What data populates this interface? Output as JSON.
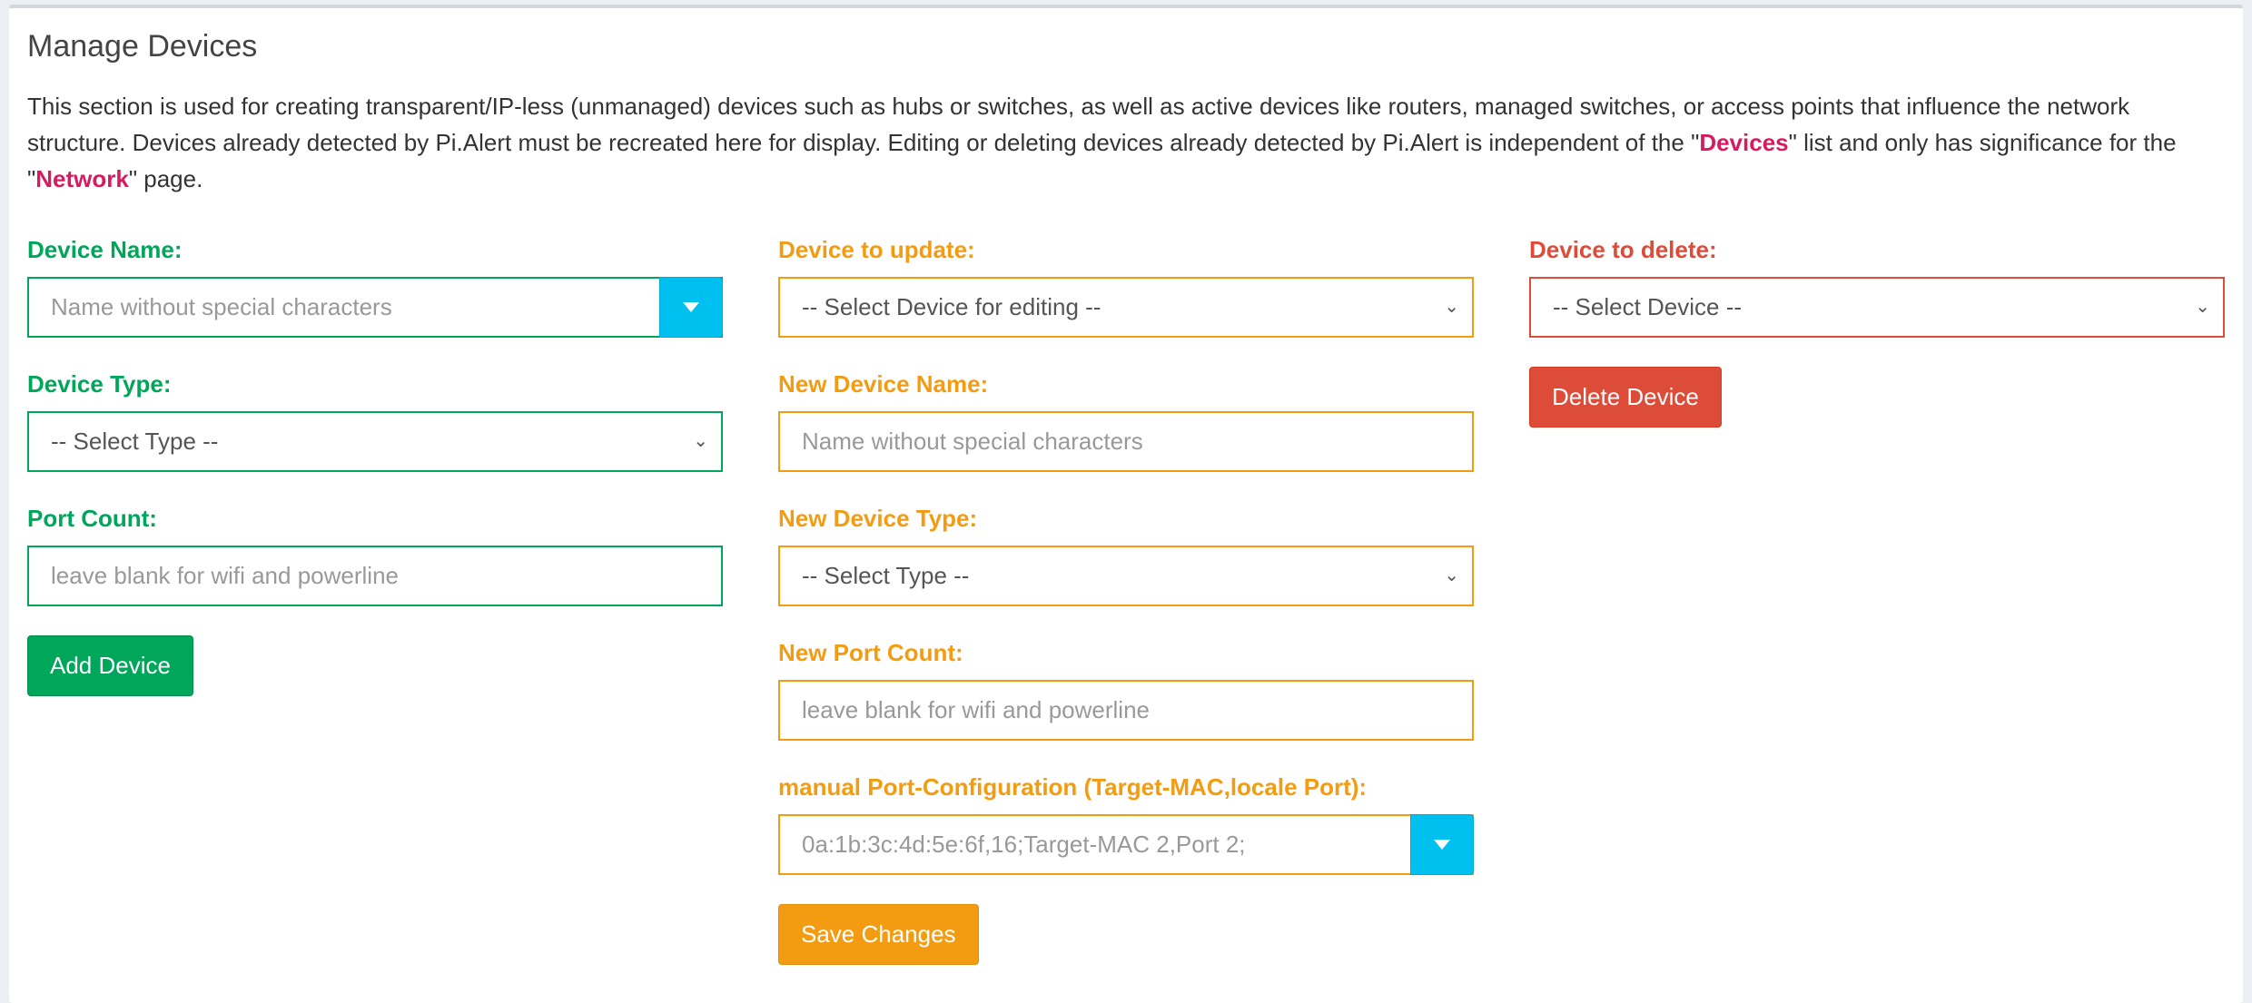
{
  "title": "Manage Devices",
  "description": {
    "part1": "This section is used for creating transparent/IP-less (unmanaged) devices such as hubs or switches, as well as active devices like routers, managed switches, or access points that influence the network structure. Devices already detected by Pi.Alert must be recreated here for display. Editing or deleting devices already detected by Pi.Alert is independent of the \"",
    "link1": "Devices",
    "part2": "\" list and only has significance for the \"",
    "link2": "Network",
    "part3": "\" page."
  },
  "add": {
    "name_label": "Device Name:",
    "name_placeholder": "Name without special characters",
    "type_label": "Device Type:",
    "type_value": "-- Select Type --",
    "ports_label": "Port Count:",
    "ports_placeholder": "leave blank for wifi and powerline",
    "button": "Add Device"
  },
  "update": {
    "device_label": "Device to update:",
    "device_value": "-- Select Device for editing --",
    "name_label": "New Device Name:",
    "name_placeholder": "Name without special characters",
    "type_label": "New Device Type:",
    "type_value": "-- Select Type --",
    "ports_label": "New Port Count:",
    "ports_placeholder": "leave blank for wifi and powerline",
    "portconfig_label": "manual Port-Configuration (Target-MAC,locale Port):",
    "portconfig_placeholder": "0a:1b:3c:4d:5e:6f,16;Target-MAC 2,Port 2;",
    "button": "Save Changes"
  },
  "delete": {
    "device_label": "Device to delete:",
    "device_value": "-- Select Device --",
    "button": "Delete Device"
  },
  "colors": {
    "add": "#00a65a",
    "update": "#f39c12",
    "delete": "#dd4b39",
    "addon": "#00c0ef",
    "link": "#d81b60"
  },
  "icons": {
    "dropdown_addon": "caret-down-icon",
    "select_chevron": "chevron-down-icon"
  }
}
